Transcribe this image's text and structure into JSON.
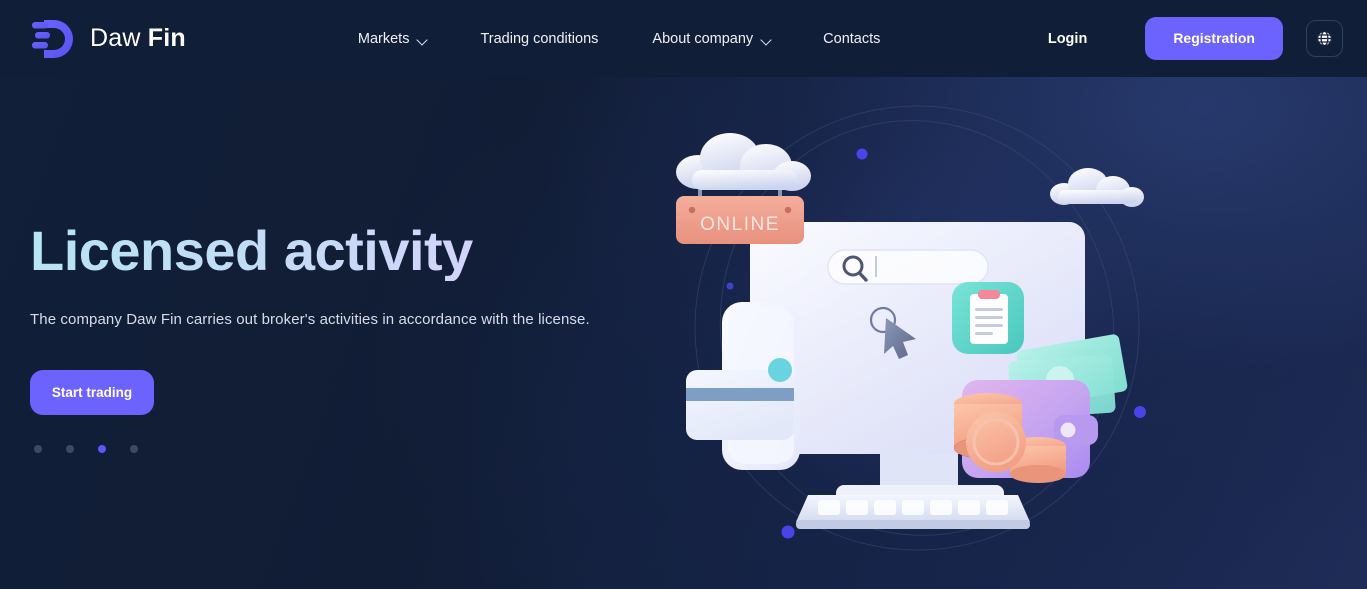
{
  "header": {
    "brand": {
      "name_light": "Daw",
      "name_bold": "Fin",
      "logo_icon": "dawfin-d-logo-icon"
    },
    "nav": [
      {
        "label": "Markets",
        "has_dropdown": true,
        "icon": "chevron-down-icon"
      },
      {
        "label": "Trading conditions",
        "has_dropdown": false
      },
      {
        "label": "About company",
        "has_dropdown": true,
        "icon": "chevron-down-icon"
      },
      {
        "label": "Contacts",
        "has_dropdown": false
      }
    ],
    "login_label": "Login",
    "registration_label": "Registration",
    "language_icon": "globe-icon"
  },
  "hero": {
    "title": "Licensed activity",
    "subtitle": "The company Daw Fin carries out broker's activities in accordance with the license.",
    "cta_label": "Start trading",
    "carousel": {
      "total": 4,
      "active_index": 2
    }
  },
  "illustration": {
    "sign_label": "ONLINE",
    "objects": [
      "cloud-large-icon",
      "cloud-small-icon",
      "online-sign-icon",
      "monitor-icon",
      "search-bar-icon",
      "cursor-icon",
      "clipboard-icon",
      "wallet-icon",
      "coins-icon",
      "banknotes-icon",
      "smartphone-icon",
      "credit-card-icon",
      "keyboard-icon",
      "orbit-ring-icon",
      "orbit-dot-icon"
    ]
  },
  "colors": {
    "background_dark": "#111f38",
    "background_light": "#1e2c57",
    "accent_purple": "#6c63ff",
    "dot_active": "#6056f5",
    "dot_inactive": "#3c4a66",
    "text_primary": "#ffffff",
    "text_secondary": "#d6dcea",
    "title_gradient_start": "#b7e4f4",
    "title_gradient_end": "#dcd6fb",
    "sign_salmon": "#ef9e8e",
    "clipboard_teal": "#5ed6ca",
    "wallet_pink": "#d9a8e8",
    "banknote_mint": "#8fe8df",
    "coin_peach": "#f7b39a"
  }
}
